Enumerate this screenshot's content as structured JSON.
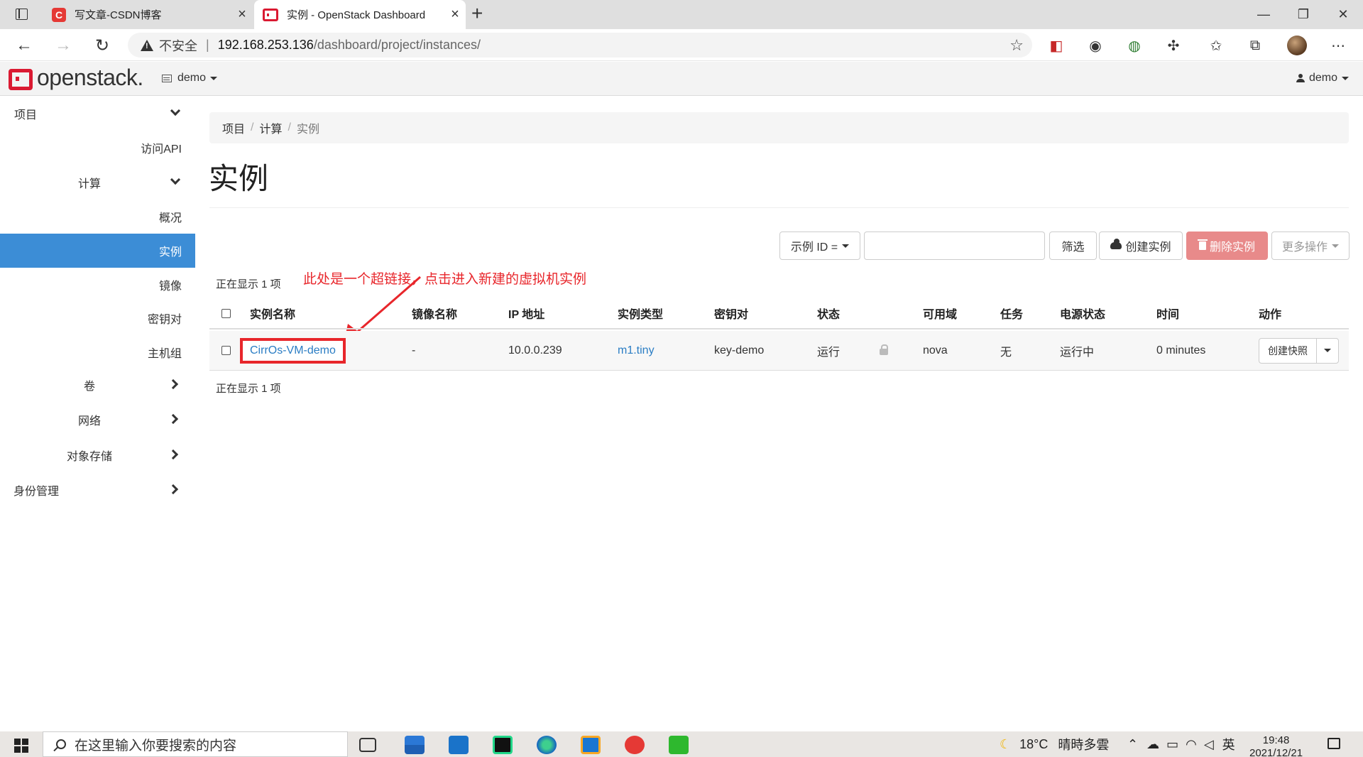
{
  "browser": {
    "tabs": [
      {
        "title": "写文章-CSDN博客",
        "favicon": "C"
      },
      {
        "title": "实例 - OpenStack Dashboard"
      }
    ],
    "new_tab": "+",
    "close": "×",
    "insecure_label": "不安全",
    "address_separator": "|",
    "url_host": "192.168.253.136",
    "url_path": "/dashboard/project/instances/",
    "window_controls": {
      "minimize": "—",
      "maximize": "❐",
      "close": "✕"
    }
  },
  "header": {
    "logo": "openstack.",
    "project": "demo",
    "user": "demo"
  },
  "sidebar": {
    "items": [
      {
        "label": "项目"
      },
      {
        "label": "访问API"
      },
      {
        "label": "计算"
      },
      {
        "label": "概况"
      },
      {
        "label": "实例"
      },
      {
        "label": "镜像"
      },
      {
        "label": "密钥对"
      },
      {
        "label": "主机组"
      },
      {
        "label": "卷"
      },
      {
        "label": "网络"
      },
      {
        "label": "对象存储"
      },
      {
        "label": "身份管理"
      }
    ]
  },
  "breadcrumb": [
    "项目",
    "计算",
    "实例"
  ],
  "breadcrumb_sep": "/",
  "page_title": "实例",
  "toolbar": {
    "filter_select": "示例 ID =",
    "filter_input_value": "",
    "filter_button": "筛选",
    "create_button": "创建实例",
    "delete_button": "删除实例",
    "more_button": "更多操作"
  },
  "count_text": "正在显示 1 项",
  "annotation": "此处是一个超链接，点击进入新建的虚拟机实例",
  "table": {
    "headers": [
      "实例名称",
      "镜像名称",
      "IP 地址",
      "实例类型",
      "密钥对",
      "状态",
      "可用域",
      "任务",
      "电源状态",
      "时间",
      "动作"
    ],
    "rows": [
      {
        "name": "CirrOs-VM-demo",
        "image": "-",
        "ip": "10.0.0.239",
        "flavor": "m1.tiny",
        "keypair": "key-demo",
        "status": "运行",
        "zone": "nova",
        "task": "无",
        "power": "运行中",
        "time": "0 minutes",
        "action": "创建快照"
      }
    ]
  },
  "taskbar": {
    "search_placeholder": "在这里输入你要搜索的内容",
    "weather": "18°C",
    "weather_desc": "晴時多雲",
    "ime": "英",
    "time": "19:48",
    "date": "2021/12/21"
  },
  "colors": {
    "active_nav": "#3c8dd6",
    "link": "#2a7dc4",
    "annotation_red": "#e8262b",
    "danger_button": "#e88a8a",
    "brand_red": "#da1a32"
  }
}
